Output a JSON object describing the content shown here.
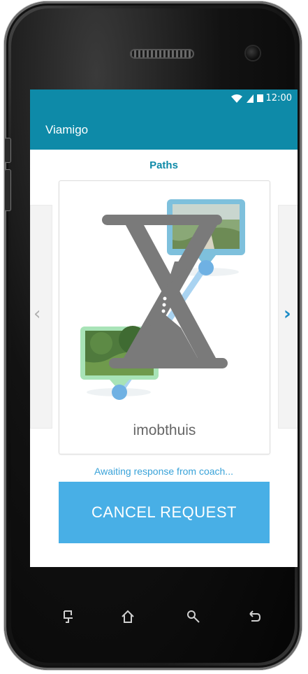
{
  "status_bar": {
    "time": "12:00"
  },
  "app_bar": {
    "title": "Viamigo"
  },
  "main": {
    "section_title": "Paths",
    "card": {
      "label": "imobthuis"
    },
    "status_message": "Awaiting response from coach...",
    "cancel_label": "CANCEL REQUEST"
  },
  "colors": {
    "primary": "#0e8aa8",
    "accent": "#48afe6",
    "loader": "#7a7a7a"
  },
  "icons": {
    "status": [
      "wifi-icon",
      "signal-icon",
      "battery-icon"
    ],
    "nav": [
      "chevron-left-icon",
      "chevron-right-icon"
    ],
    "softkeys": [
      "menu-key-icon",
      "home-key-icon",
      "search-key-icon",
      "back-key-icon"
    ]
  }
}
